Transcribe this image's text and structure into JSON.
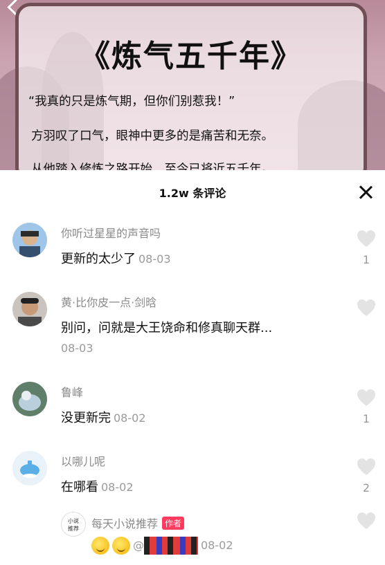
{
  "video": {
    "book_title": "《炼气五千年》",
    "lines": [
      "“我真的只是炼气期，但你们别惹我！”",
      "方羽叹了口气，眼神中更多的是痛苦和无奈。",
      "从他踏入修炼之路开始，至今已将近五千年。"
    ]
  },
  "sheet": {
    "title": "1.2w 条评论",
    "close_icon": "close-icon"
  },
  "comments": [
    {
      "name": "你听过星星的声音吗",
      "text": "更新的太少了",
      "time": "08-03",
      "likes": "1"
    },
    {
      "name": "黄·比你皮一点·剑晗",
      "text": "别问，问就是大王饶命和修真聊天群...",
      "time": "08-03",
      "likes": ""
    },
    {
      "name": "鲁峰",
      "text": "没更新完",
      "time": "08-02",
      "likes": "1"
    },
    {
      "name": "以哪儿呢",
      "text": "在哪看",
      "time": "08-02",
      "likes": "2"
    }
  ],
  "reply": {
    "name": "每天小说推荐",
    "badge": "作者",
    "avatar_text": "小说推荐",
    "mention": "@",
    "time": "08-02",
    "likes": ""
  },
  "colors": {
    "badge": "#ff3c5f",
    "frame": "#6f4e56"
  }
}
